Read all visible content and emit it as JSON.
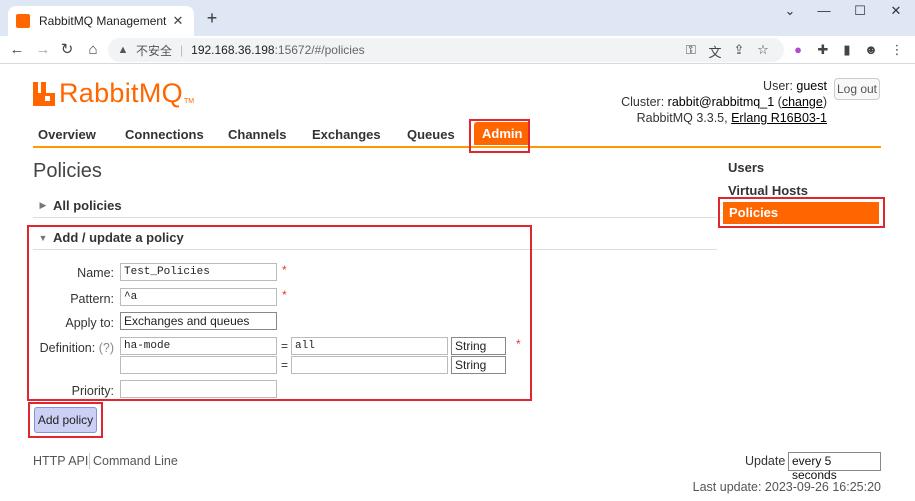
{
  "browser": {
    "tab_title": "RabbitMQ Management",
    "tab_close": "✕",
    "new_tab": "+",
    "insecure_label": "不安全",
    "url_host": "192.168.36.198",
    "url_path": ":15672/#/policies"
  },
  "header": {
    "logo_text": "RabbitMQ",
    "logo_tm": "TM",
    "user_label": "User:",
    "user": "guest",
    "cluster_label": "Cluster:",
    "cluster": "rabbit@rabbitmq_1",
    "change_link": "change",
    "version": "RabbitMQ 3.3.5,",
    "erlang": "Erlang R16B03-1",
    "logout": "Log out"
  },
  "nav": {
    "overview": "Overview",
    "connections": "Connections",
    "channels": "Channels",
    "exchanges": "Exchanges",
    "queues": "Queues",
    "admin": "Admin"
  },
  "main": {
    "title": "Policies",
    "all_policies": "All policies",
    "add_update": "Add / update a policy"
  },
  "form": {
    "name_label": "Name:",
    "name_value": "Test_Policies",
    "pattern_label": "Pattern:",
    "pattern_value": "^a",
    "apply_label": "Apply to:",
    "apply_value": "Exchanges and queues",
    "definition_label": "Definition:",
    "definition_help": "(?)",
    "def_key_1": "ha-mode",
    "def_val_1": "all",
    "def_type_1": "String",
    "def_key_2": "",
    "def_val_2": "",
    "def_type_2": "String",
    "eq": "=",
    "priority_label": "Priority:",
    "priority_value": "",
    "required": "*",
    "submit": "Add policy"
  },
  "sidebar": {
    "users": "Users",
    "vhosts": "Virtual Hosts",
    "policies": "Policies"
  },
  "footer": {
    "http_api": "HTTP API",
    "command_line": "Command Line",
    "update_label": "Update",
    "update_value": "every 5 seconds",
    "last_update": "Last update: 2023-09-26 16:25:20"
  }
}
